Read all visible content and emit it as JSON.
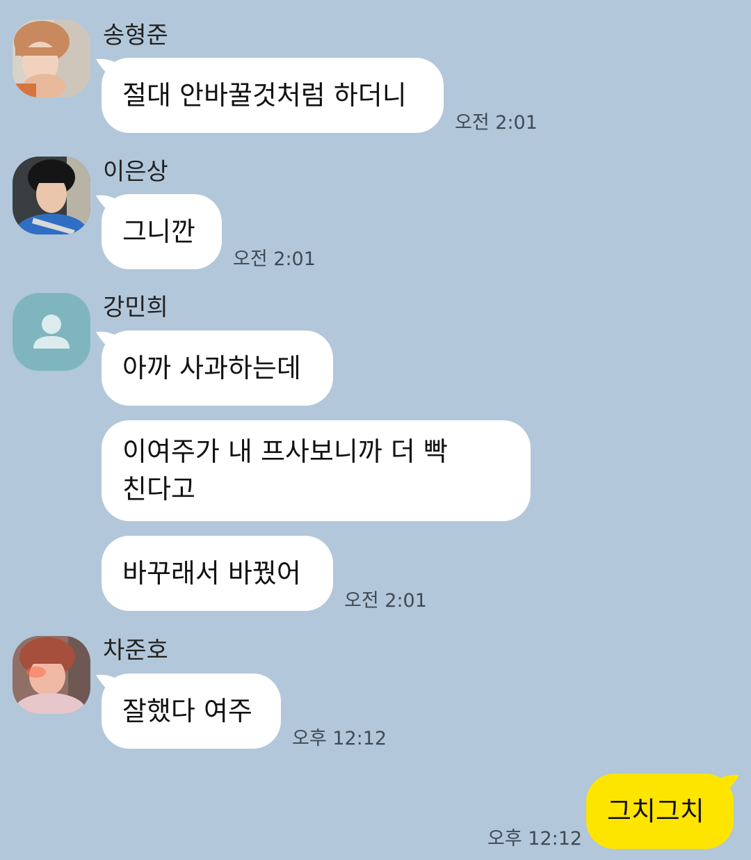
{
  "colors": {
    "background": "#b2c7da",
    "bubble_other": "#ffffff",
    "bubble_mine": "#fee500",
    "default_avatar_bg": "#7fb5bf"
  },
  "messages": [
    {
      "sender": "송형준",
      "avatar": "photo",
      "bubbles": [
        "절대 안바꿀것처럼 하더니"
      ],
      "time": "오전 2:01"
    },
    {
      "sender": "이은상",
      "avatar": "photo",
      "bubbles": [
        "그니깐"
      ],
      "time": "오전 2:01"
    },
    {
      "sender": "강민희",
      "avatar": "default-user-icon",
      "bubbles": [
        "아까 사과하는데",
        "이여주가 내 프사보니까 더 빡친다고",
        "바꾸래서 바꿨어"
      ],
      "time": "오전 2:01"
    },
    {
      "sender": "차준호",
      "avatar": "photo",
      "bubbles": [
        "잘했다 여주"
      ],
      "time": "오후 12:12"
    }
  ],
  "my_message": {
    "text": "그치그치",
    "time": "오후 12:12"
  }
}
